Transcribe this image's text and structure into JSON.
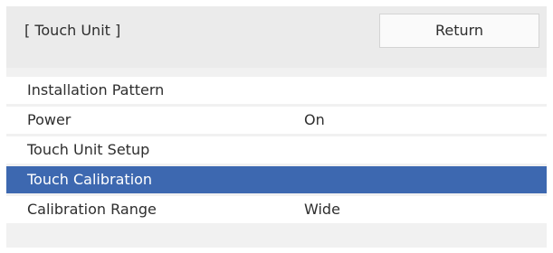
{
  "header": {
    "title": "[ Touch Unit ]",
    "return_label": "Return"
  },
  "menu": {
    "items": [
      {
        "label": "Installation Pattern",
        "value": ""
      },
      {
        "label": "Power",
        "value": "On"
      },
      {
        "label": "Touch Unit Setup",
        "value": ""
      },
      {
        "label": "Touch Calibration",
        "value": "",
        "selected": true
      },
      {
        "label": "Calibration Range",
        "value": "Wide"
      }
    ]
  },
  "colors": {
    "selection": "#3d68b0",
    "panel_background": "#f1f1f1",
    "item_background": "#ffffff",
    "text": "#2e2e2e"
  }
}
